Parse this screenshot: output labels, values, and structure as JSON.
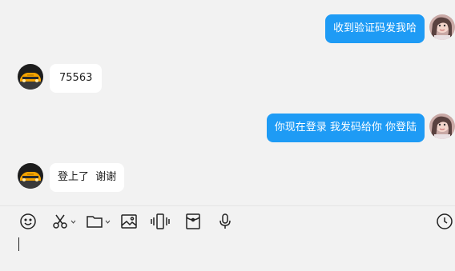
{
  "messages": [
    {
      "side": "right",
      "text": "收到验证码发我哈",
      "sender": "me"
    },
    {
      "side": "left",
      "text": "75563",
      "sender": "contact"
    },
    {
      "side": "right",
      "text": "你现在登录 我发码给你 你登陆",
      "sender": "me"
    },
    {
      "side": "left",
      "text": "登上了  谢谢",
      "sender": "contact"
    }
  ],
  "colors": {
    "sent_bubble": "#1e9bf5",
    "received_bubble": "#ffffff",
    "background": "#f2f2f2"
  },
  "toolbar": {
    "icons": [
      "emoji-icon",
      "scissors-icon",
      "folder-icon",
      "image-icon",
      "shake-icon",
      "red-packet-icon",
      "microphone-icon",
      "history-clock-icon"
    ]
  },
  "input": {
    "value": ""
  }
}
